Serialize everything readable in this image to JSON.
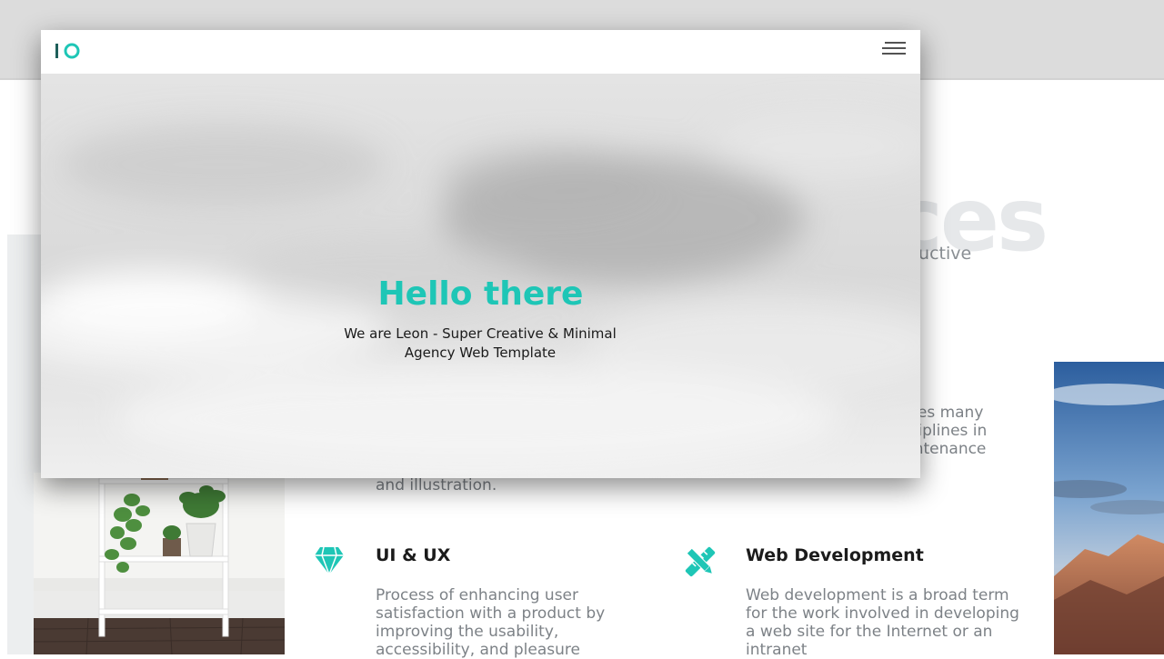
{
  "window": {
    "logo_text": "IO",
    "hero": {
      "title": "Hello there",
      "subtitle": "We are Leon - Super Creative & Minimal Agency Web Template"
    },
    "menu_icon": "hamburger-menu-icon"
  },
  "background_page": {
    "heading_fragment": "ces",
    "subheading_fragment": "ductive",
    "right_desc_fragment": "ses many ciplines in intenance",
    "left_desc_tail": "and illustration.",
    "services": [
      {
        "icon": "diamond-icon",
        "title": "UI & UX",
        "description": "Process of enhancing user satisfaction with a product by improving the usability, accessibility, and pleasure"
      },
      {
        "icon": "pencil-ruler-icon",
        "title": "Web Development",
        "description": "Web development is a broad term for the work involved in developing a web site for the Internet or an intranet"
      }
    ]
  },
  "colors": {
    "accent": "#1ec6b6",
    "text_dark": "#1b1b1b",
    "text_muted": "#7d8287"
  }
}
